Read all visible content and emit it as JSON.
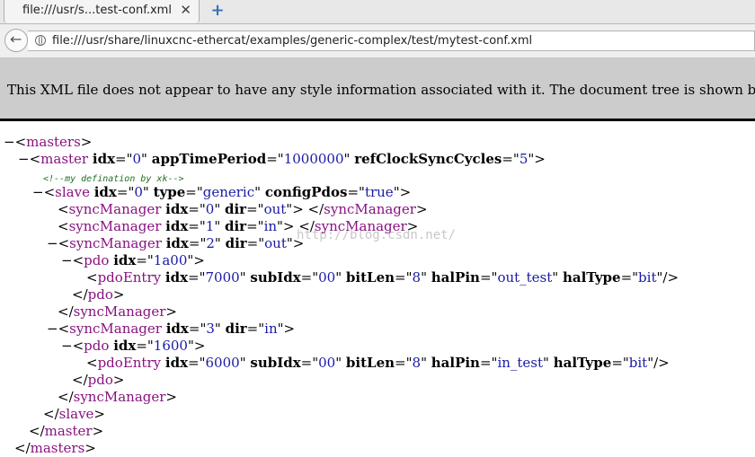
{
  "tab": {
    "title": "file:///usr/s...test-conf.xml",
    "close": "✕",
    "newtab": "+"
  },
  "nav": {
    "back": "←",
    "url": "file:///usr/share/linuxcnc-ethercat/examples/generic-complex/test/mytest-conf.xml"
  },
  "info": {
    "text": "This XML file does not appear to have any style information associated with it. The document tree is shown below."
  },
  "watermark": "http://blog.csdn.net/",
  "xml": {
    "masters_tag": "masters",
    "master": {
      "tag": "master",
      "idx": "0",
      "appTimePeriod": "1000000",
      "refClockSyncCycles": "5"
    },
    "comment": "<!--my defination by xk-->",
    "slave": {
      "tag": "slave",
      "idx": "0",
      "type": "generic",
      "configPdos": "true"
    },
    "sm0": {
      "tag": "syncManager",
      "idx": "0",
      "dir": "out"
    },
    "sm1": {
      "tag": "syncManager",
      "idx": "1",
      "dir": "in"
    },
    "sm2": {
      "tag": "syncManager",
      "idx": "2",
      "dir": "out"
    },
    "pdo1": {
      "tag": "pdo",
      "idx": "1a00"
    },
    "entry1": {
      "tag": "pdoEntry",
      "idx": "7000",
      "subIdx": "00",
      "bitLen": "8",
      "halPin": "out_test",
      "halType": "bit"
    },
    "sm3": {
      "tag": "syncManager",
      "idx": "3",
      "dir": "in"
    },
    "pdo2": {
      "tag": "pdo",
      "idx": "1600"
    },
    "entry2": {
      "tag": "pdoEntry",
      "idx": "6000",
      "subIdx": "00",
      "bitLen": "8",
      "halPin": "in_test",
      "halType": "bit"
    },
    "attr": {
      "idx": "idx",
      "appTimePeriod": "appTimePeriod",
      "refClockSyncCycles": "refClockSyncCycles",
      "type": "type",
      "configPdos": "configPdos",
      "dir": "dir",
      "subIdx": "subIdx",
      "bitLen": "bitLen",
      "halPin": "halPin",
      "halType": "halType"
    }
  }
}
